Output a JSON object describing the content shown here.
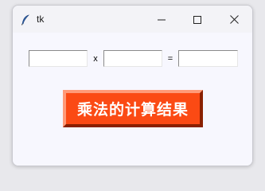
{
  "window": {
    "title": "tk",
    "app_icon": "feather-icon",
    "controls": {
      "minimize": "minimize-icon",
      "maximize": "maximize-icon",
      "close": "close-icon"
    }
  },
  "form": {
    "multiplicand_value": "",
    "operator_multiply": "x",
    "multiplier_value": "",
    "operator_equals": "=",
    "result_value": ""
  },
  "button": {
    "label": "乘法的计算结果",
    "color": "#fb4a14",
    "text_color": "#ffffff"
  }
}
